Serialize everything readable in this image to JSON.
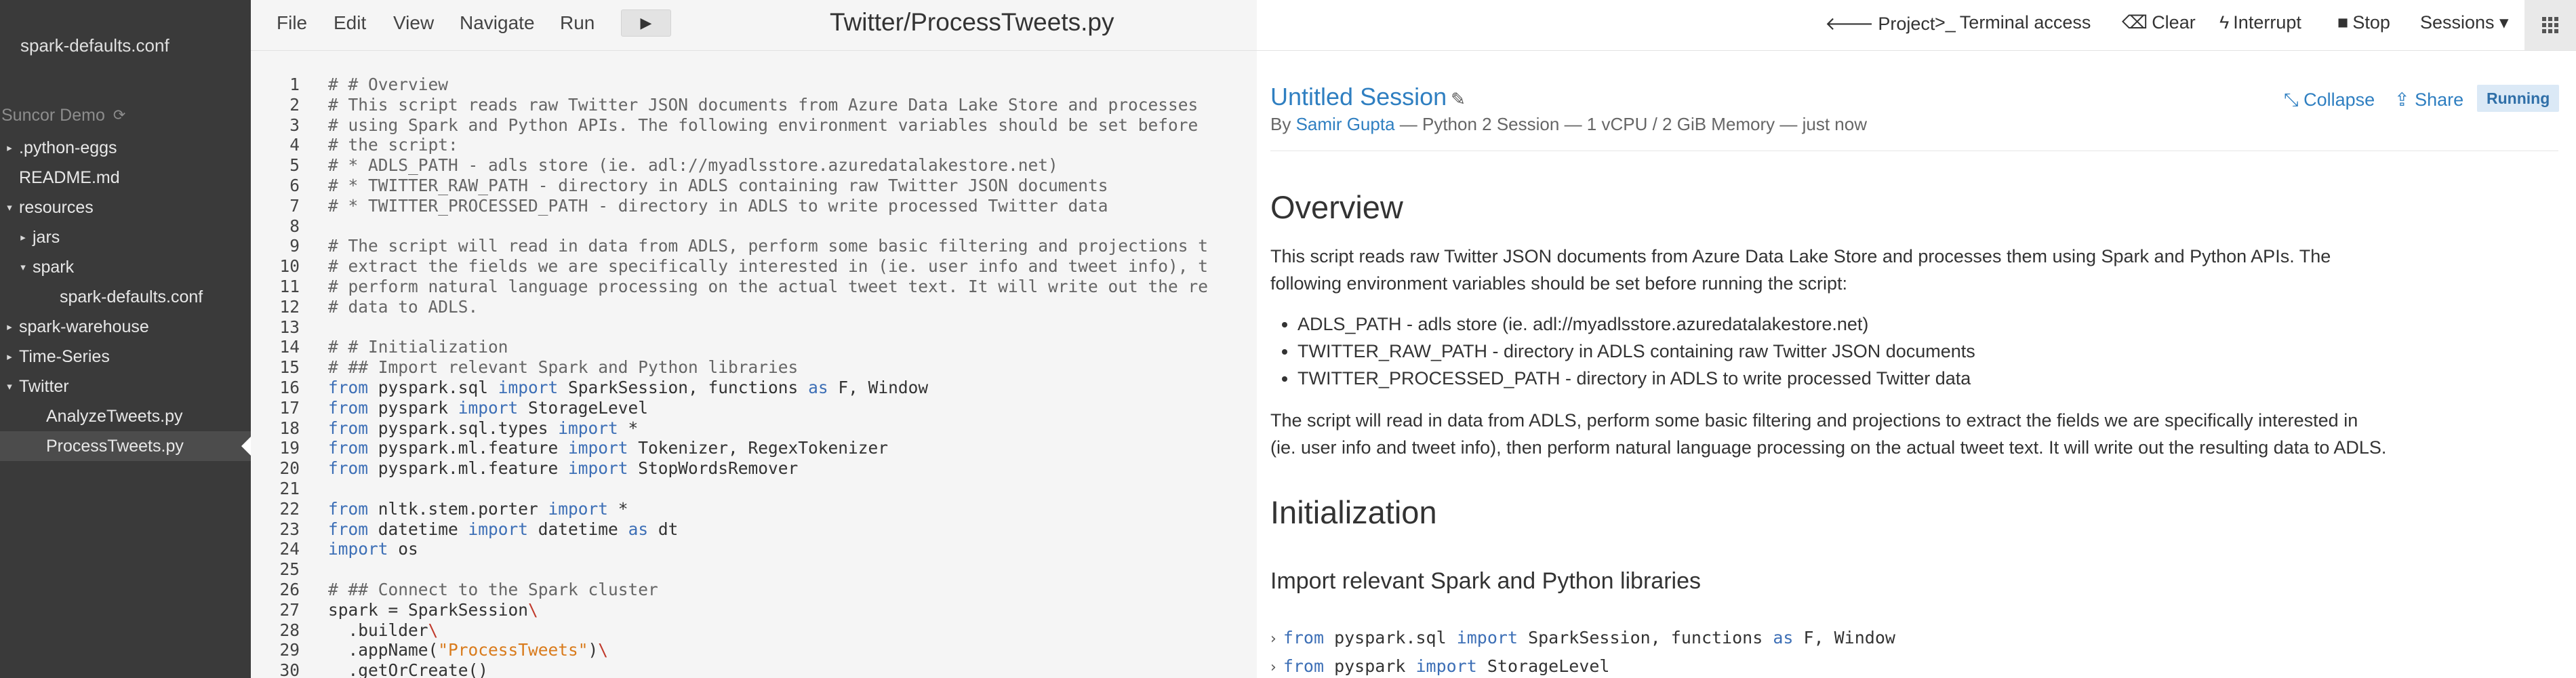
{
  "sidebar": {
    "open_file": "spark-defaults.conf",
    "project_name": "Suncor Demo",
    "tree": [
      {
        "label": ".python-eggs",
        "caret": "▸",
        "indent": 0,
        "selected": false
      },
      {
        "label": "README.md",
        "caret": "",
        "indent": 0,
        "selected": false
      },
      {
        "label": "resources",
        "caret": "▾",
        "indent": 0,
        "selected": false
      },
      {
        "label": "jars",
        "caret": "▸",
        "indent": 1,
        "selected": false
      },
      {
        "label": "spark",
        "caret": "▾",
        "indent": 1,
        "selected": false
      },
      {
        "label": "spark-defaults.conf",
        "caret": "",
        "indent": 3,
        "selected": false
      },
      {
        "label": "spark-warehouse",
        "caret": "▸",
        "indent": 0,
        "selected": false
      },
      {
        "label": "Time-Series",
        "caret": "▸",
        "indent": 0,
        "selected": false
      },
      {
        "label": "Twitter",
        "caret": "▾",
        "indent": 0,
        "selected": false
      },
      {
        "label": "AnalyzeTweets.py",
        "caret": "",
        "indent": 2,
        "selected": false
      },
      {
        "label": "ProcessTweets.py",
        "caret": "",
        "indent": 2,
        "selected": true
      }
    ]
  },
  "editor": {
    "menu": [
      "File",
      "Edit",
      "View",
      "Navigate",
      "Run"
    ],
    "run_icon": "play-icon",
    "file_title": "Twitter/ProcessTweets.py",
    "lines": [
      [
        {
          "t": "# # Overview",
          "c": "comment"
        }
      ],
      [
        {
          "t": "# This script reads raw Twitter JSON documents from Azure Data Lake Store and processes",
          "c": "comment"
        }
      ],
      [
        {
          "t": "# using Spark and Python APIs. The following environment variables should be set before",
          "c": "comment"
        }
      ],
      [
        {
          "t": "# the script:",
          "c": "comment"
        }
      ],
      [
        {
          "t": "# * ADLS_PATH - adls store (ie. adl://myadlsstore.azuredatalakestore.net)",
          "c": "comment"
        }
      ],
      [
        {
          "t": "# * TWITTER_RAW_PATH - directory in ADLS containing raw Twitter JSON documents",
          "c": "comment"
        }
      ],
      [
        {
          "t": "# * TWITTER_PROCESSED_PATH - directory in ADLS to write processed Twitter data",
          "c": "comment"
        }
      ],
      [],
      [
        {
          "t": "# The script will read in data from ADLS, perform some basic filtering and projections t",
          "c": "comment"
        }
      ],
      [
        {
          "t": "# extract the fields we are specifically interested in (ie. user info and tweet info), t",
          "c": "comment"
        }
      ],
      [
        {
          "t": "# perform natural language processing on the actual tweet text. It will write out the re",
          "c": "comment"
        }
      ],
      [
        {
          "t": "# data to ADLS.",
          "c": "comment"
        }
      ],
      [],
      [
        {
          "t": "# # Initialization",
          "c": "comment"
        }
      ],
      [
        {
          "t": "# ## Import relevant Spark and Python libraries",
          "c": "comment"
        }
      ],
      [
        {
          "t": "from",
          "c": "kw"
        },
        {
          "t": " pyspark.sql ",
          "c": ""
        },
        {
          "t": "import",
          "c": "kw"
        },
        {
          "t": " SparkSession, functions ",
          "c": ""
        },
        {
          "t": "as",
          "c": "kw"
        },
        {
          "t": " F, Window",
          "c": ""
        }
      ],
      [
        {
          "t": "from",
          "c": "kw"
        },
        {
          "t": " pyspark ",
          "c": ""
        },
        {
          "t": "import",
          "c": "kw"
        },
        {
          "t": " StorageLevel",
          "c": ""
        }
      ],
      [
        {
          "t": "from",
          "c": "kw"
        },
        {
          "t": " pyspark.sql.types ",
          "c": ""
        },
        {
          "t": "import",
          "c": "kw"
        },
        {
          "t": " *",
          "c": ""
        }
      ],
      [
        {
          "t": "from",
          "c": "kw"
        },
        {
          "t": " pyspark.ml.feature ",
          "c": ""
        },
        {
          "t": "import",
          "c": "kw"
        },
        {
          "t": " Tokenizer, RegexTokenizer",
          "c": ""
        }
      ],
      [
        {
          "t": "from",
          "c": "kw"
        },
        {
          "t": " pyspark.ml.feature ",
          "c": ""
        },
        {
          "t": "import",
          "c": "kw"
        },
        {
          "t": " StopWordsRemover",
          "c": ""
        }
      ],
      [],
      [
        {
          "t": "from",
          "c": "kw"
        },
        {
          "t": " nltk.stem.porter ",
          "c": ""
        },
        {
          "t": "import",
          "c": "kw"
        },
        {
          "t": " *",
          "c": ""
        }
      ],
      [
        {
          "t": "from",
          "c": "kw"
        },
        {
          "t": " datetime ",
          "c": ""
        },
        {
          "t": "import",
          "c": "kw"
        },
        {
          "t": " datetime ",
          "c": ""
        },
        {
          "t": "as",
          "c": "kw"
        },
        {
          "t": " dt",
          "c": ""
        }
      ],
      [
        {
          "t": "import",
          "c": "kw"
        },
        {
          "t": " os",
          "c": ""
        }
      ],
      [],
      [
        {
          "t": "# ## Connect to the Spark cluster",
          "c": "comment"
        }
      ],
      [
        {
          "t": "spark = SparkSession",
          "c": ""
        },
        {
          "t": "\\",
          "c": "esc"
        }
      ],
      [
        {
          "t": "  .builder",
          "c": ""
        },
        {
          "t": "\\",
          "c": "esc"
        }
      ],
      [
        {
          "t": "  .appName(",
          "c": ""
        },
        {
          "t": "\"ProcessTweets\"",
          "c": "str"
        },
        {
          "t": ")",
          "c": ""
        },
        {
          "t": "\\",
          "c": "esc"
        }
      ],
      [
        {
          "t": "  .getOrCreate()",
          "c": ""
        }
      ]
    ]
  },
  "session": {
    "toolbar": [
      {
        "icon": "arrow-left-icon",
        "glyph": "🡐",
        "label": "Project"
      },
      {
        "icon": "terminal-icon",
        "glyph": ">_",
        "label": "Terminal access"
      },
      {
        "icon": "eraser-icon",
        "glyph": "⌫",
        "label": "Clear"
      },
      {
        "icon": "bolt-icon",
        "glyph": "ϟ",
        "label": "Interrupt"
      },
      {
        "icon": "stop-icon",
        "glyph": "■",
        "label": "Stop"
      },
      {
        "icon": "chevron-down-icon",
        "glyph": "",
        "label": "Sessions ▾"
      }
    ],
    "title": "Untitled Session",
    "by_prefix": "By",
    "user": "Samir Gupta",
    "details": "— Python 2 Session — 1 vCPU / 2 GiB Memory — just now",
    "collapse_label": "Collapse",
    "share_label": "Share",
    "status": "Running",
    "overview_heading": "Overview",
    "overview_p1a": "This script reads raw Twitter JSON documents from Azure Data Lake Store and processes them using Spark and Python APIs. The",
    "overview_p1b": "following environment variables should be set before running the script:",
    "bullets": [
      "ADLS_PATH - adls store (ie. adl://myadlsstore.azuredatalakestore.net)",
      "TWITTER_RAW_PATH - directory in ADLS containing raw Twitter JSON documents",
      "TWITTER_PROCESSED_PATH - directory in ADLS to write processed Twitter data"
    ],
    "overview_p2a": "The script will read in data from ADLS, perform some basic filtering and projections to extract the fields we are specifically interested in",
    "overview_p2b": "(ie. user info and tweet info), then perform natural language processing on the actual tweet text. It will write out the resulting data to ADLS.",
    "init_heading": "Initialization",
    "import_heading": "Import relevant Spark and Python libraries",
    "inputs": [
      [
        {
          "t": "from",
          "c": "kw"
        },
        {
          "t": " pyspark.sql ",
          "c": ""
        },
        {
          "t": "import",
          "c": "kw"
        },
        {
          "t": " SparkSession, functions ",
          "c": ""
        },
        {
          "t": "as",
          "c": "kw"
        },
        {
          "t": " F, Window",
          "c": ""
        }
      ],
      [
        {
          "t": "from",
          "c": "kw"
        },
        {
          "t": " pyspark ",
          "c": ""
        },
        {
          "t": "import",
          "c": "kw"
        },
        {
          "t": " StorageLevel",
          "c": ""
        }
      ]
    ]
  }
}
